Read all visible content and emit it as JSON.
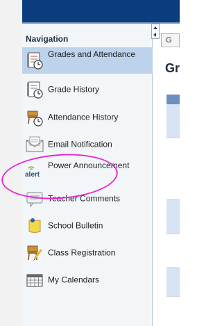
{
  "navigation": {
    "heading": "Navigation",
    "items": [
      {
        "label": "Grades and Attendance",
        "icon": "grades-icon",
        "active": true
      },
      {
        "label": "Grade History",
        "icon": "grade-history-icon"
      },
      {
        "label": "Attendance History",
        "icon": "attendance-history-icon"
      },
      {
        "label": "Email Notification",
        "icon": "email-icon"
      },
      {
        "label": "Power Announcement",
        "icon": "alert-icon"
      },
      {
        "label": "Teacher Comments",
        "icon": "comments-icon"
      },
      {
        "label": "School Bulletin",
        "icon": "bulletin-icon"
      },
      {
        "label": "Class Registration",
        "icon": "registration-icon"
      },
      {
        "label": "My Calendars",
        "icon": "calendar-icon"
      }
    ]
  },
  "main": {
    "tab_label": "G",
    "page_title": "Gr"
  },
  "colors": {
    "top_bar": "#0b3d7e",
    "active_item": "#bdd3ec",
    "highlight": "#e629d4"
  }
}
